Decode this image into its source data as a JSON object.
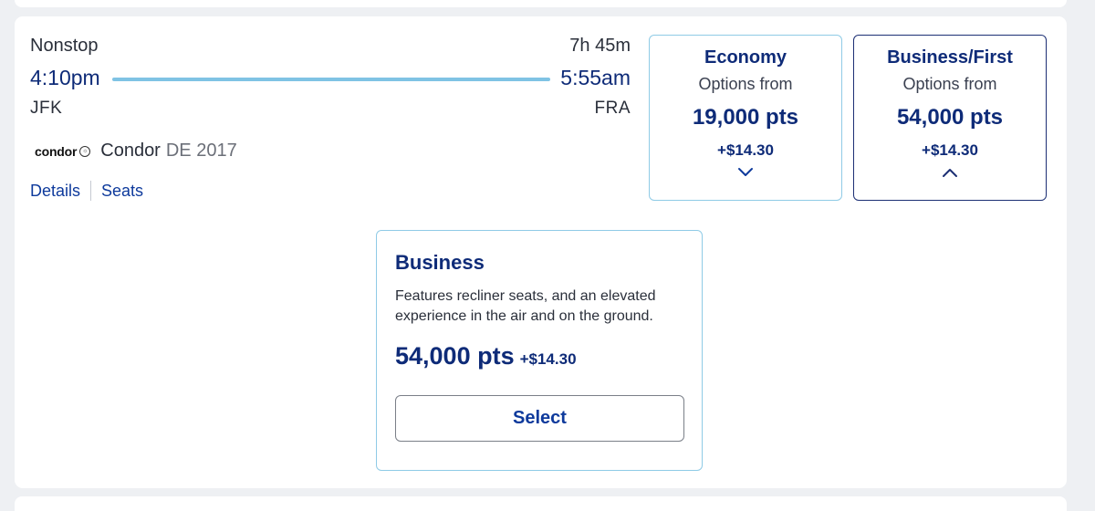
{
  "flight": {
    "stop_type": "Nonstop",
    "duration": "7h 45m",
    "departure": {
      "time": "4:10pm",
      "airport": "JFK"
    },
    "arrival": {
      "time": "5:55am",
      "airport": "FRA"
    },
    "airline": {
      "logo_text": "condor",
      "name": "Condor",
      "flight_number": "DE 2017"
    },
    "links": {
      "details": "Details",
      "seats": "Seats"
    }
  },
  "fares": {
    "economy": {
      "title": "Economy",
      "subtitle": "Options from",
      "points": "19,000 pts",
      "fee": "+$14.30",
      "expanded": false
    },
    "business_first": {
      "title": "Business/First",
      "subtitle": "Options from",
      "points": "54,000 pts",
      "fee": "+$14.30",
      "expanded": true
    }
  },
  "selected_fare": {
    "title": "Business",
    "description": "Features recliner seats, and an elevated experience in the air and on the ground.",
    "points": "54,000 pts",
    "fee": "+$14.30",
    "button_label": "Select"
  },
  "colors": {
    "accent_navy": "#0e2b78",
    "link_blue": "#0e3a9c",
    "route_line": "#7fc3e4",
    "light_border": "#8fcbe6",
    "background": "#eef0f3"
  },
  "icons": {
    "economy_toggle": "chevron-down-icon",
    "business_toggle": "chevron-up-icon",
    "airline_logo_mark": "condor-logo-mark"
  }
}
